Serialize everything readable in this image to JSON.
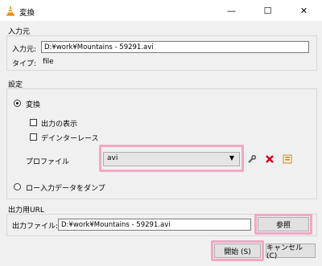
{
  "window": {
    "title": "変換",
    "app_icon": "vlc-cone-icon",
    "controls": {
      "minimize": "—",
      "maximize": "☐",
      "close": "✕"
    }
  },
  "source": {
    "group_label": "入力元",
    "input_label": "入力元:",
    "input_value": "D:¥work¥Mountains - 59291.avi",
    "type_label": "タイプ:",
    "type_value": "file"
  },
  "settings": {
    "group_label": "設定",
    "convert_label": "変換",
    "show_output_label": "出力の表示",
    "deinterlace_label": "デインターレース",
    "profile_label": "プロファイル",
    "profile_value": "avi",
    "dump_raw_label": "ロー入力データをダンプ",
    "icons": {
      "edit": "wrench-icon",
      "delete": "delete-x-icon",
      "new": "new-profile-icon"
    }
  },
  "output": {
    "group_label": "出力用URL",
    "file_label": "出力ファイル:",
    "file_value": "D:¥work¥Mountains - 59291.avi",
    "browse_label": "参照"
  },
  "footer": {
    "start_label": "開始 (S)",
    "cancel_label": "キャンセル (C)"
  },
  "colors": {
    "highlight": "#f2a7c4",
    "delete_red": "#d0021b",
    "cone_orange": "#f08c00"
  }
}
